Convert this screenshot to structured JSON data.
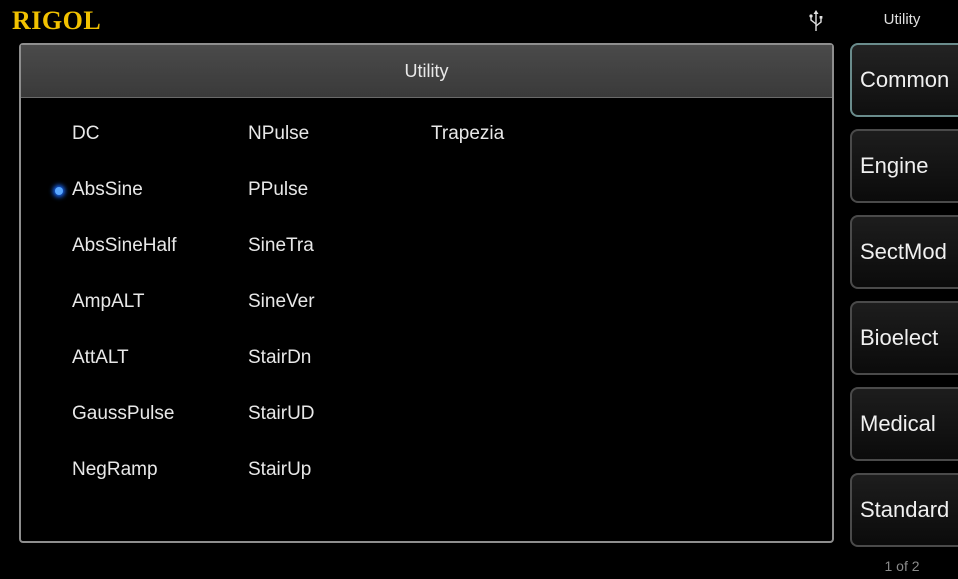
{
  "header": {
    "brand": "RIGOL",
    "menu_title": "Utility",
    "usb_icon": "usb-icon"
  },
  "panel": {
    "title": "Utility",
    "selected": "AbsSine",
    "columns": [
      [
        "DC",
        "AbsSine",
        "AbsSineHalf",
        "AmpALT",
        "AttALT",
        "GaussPulse",
        "NegRamp"
      ],
      [
        "NPulse",
        "PPulse",
        "SineTra",
        "SineVer",
        "StairDn",
        "StairUD",
        "StairUp"
      ],
      [
        "Trapezia"
      ]
    ]
  },
  "softkeys": [
    {
      "label": "Common",
      "active": true
    },
    {
      "label": "Engine",
      "active": false
    },
    {
      "label": "SectMod",
      "active": false
    },
    {
      "label": "Bioelect",
      "active": false
    },
    {
      "label": "Medical",
      "active": false
    },
    {
      "label": "Standard",
      "active": false
    }
  ],
  "page_indicator": "1 of 2",
  "colors": {
    "brand": "#f2c200",
    "selection": "#5aa8ff",
    "panel_border": "#8e8e8e"
  }
}
